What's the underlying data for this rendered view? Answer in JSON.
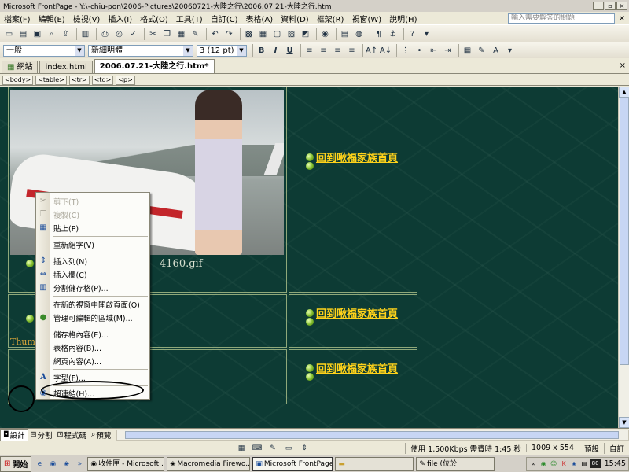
{
  "window": {
    "title": "Microsoft FrontPage - Y:\\-chiu-pon\\2006-Pictures\\20060721-大陸之行\\2006.07.21-大陸之行.htm",
    "controls": [
      "_",
      "▫",
      "×"
    ]
  },
  "menu": {
    "items": [
      "檔案(F)",
      "編輯(E)",
      "檢視(V)",
      "插入(I)",
      "格式(O)",
      "工具(T)",
      "自訂(C)",
      "表格(A)",
      "資料(D)",
      "框架(R)",
      "視窗(W)",
      "說明(H)"
    ],
    "help_placeholder": "輸入需要解答的問題",
    "doc_close": "×"
  },
  "format_toolbar": {
    "style": "一般",
    "font": "新細明體",
    "size": "3 (12 pt)",
    "bold": "B",
    "italic": "I",
    "underline": "U"
  },
  "doc_tabs": {
    "tabs": [
      "網站",
      "index.html",
      "2006.07.21-大陸之行.htm*"
    ],
    "close": "×"
  },
  "tag_bar": [
    "<body>",
    "<table>",
    "<tr>",
    "<td>",
    "<p>"
  ],
  "page": {
    "filename_fragment": "4160.gif",
    "thumb_label": "Thumb",
    "home_link": "回到啾福家族首頁"
  },
  "context_menu": {
    "items": [
      {
        "label": "剪下(T)",
        "icon": "cut-icon",
        "disabled": true
      },
      {
        "label": "複製(C)",
        "icon": "copy-icon",
        "disabled": true
      },
      {
        "label": "貼上(P)",
        "icon": "paste-icon",
        "disabled": false
      },
      {
        "label": "重新組字(V)",
        "icon": "",
        "disabled": false
      },
      {
        "label": "插入列(N)",
        "icon": "insert-row-icon",
        "disabled": false
      },
      {
        "label": "插入欄(C)",
        "icon": "insert-column-icon",
        "disabled": false
      },
      {
        "label": "分割儲存格(P)...",
        "icon": "split-cell-icon",
        "disabled": false
      },
      {
        "label": "在新的視窗中開啟頁面(O)",
        "icon": "",
        "disabled": false
      },
      {
        "label": "管理可編輯的區域(M)...",
        "icon": "editable-region-icon",
        "disabled": false
      },
      {
        "label": "儲存格內容(E)...",
        "icon": "",
        "disabled": false
      },
      {
        "label": "表格內容(B)...",
        "icon": "",
        "disabled": false
      },
      {
        "label": "網頁內容(A)...",
        "icon": "",
        "disabled": false
      },
      {
        "label": "字型(F)...",
        "icon": "font-icon",
        "disabled": false
      },
      {
        "label": "超連結(H)...",
        "icon": "hyperlink-icon",
        "disabled": false
      }
    ]
  },
  "view_tabs": [
    "設計",
    "分割",
    "程式碼",
    "預覽"
  ],
  "status": {
    "speed": "使用 1,500Kbps 需費時 1:45 秒",
    "size": "1009 x 554",
    "mode": "預設",
    "custom": "自訂"
  },
  "taskbar": {
    "start": "開始",
    "tasks": [
      "收件匣 - Microsoft ...",
      "Macromedia Firewo...",
      "Microsoft FrontPage...",
      "",
      "file (位於"
    ],
    "clock": "15:45",
    "tray_badge": "80"
  }
}
